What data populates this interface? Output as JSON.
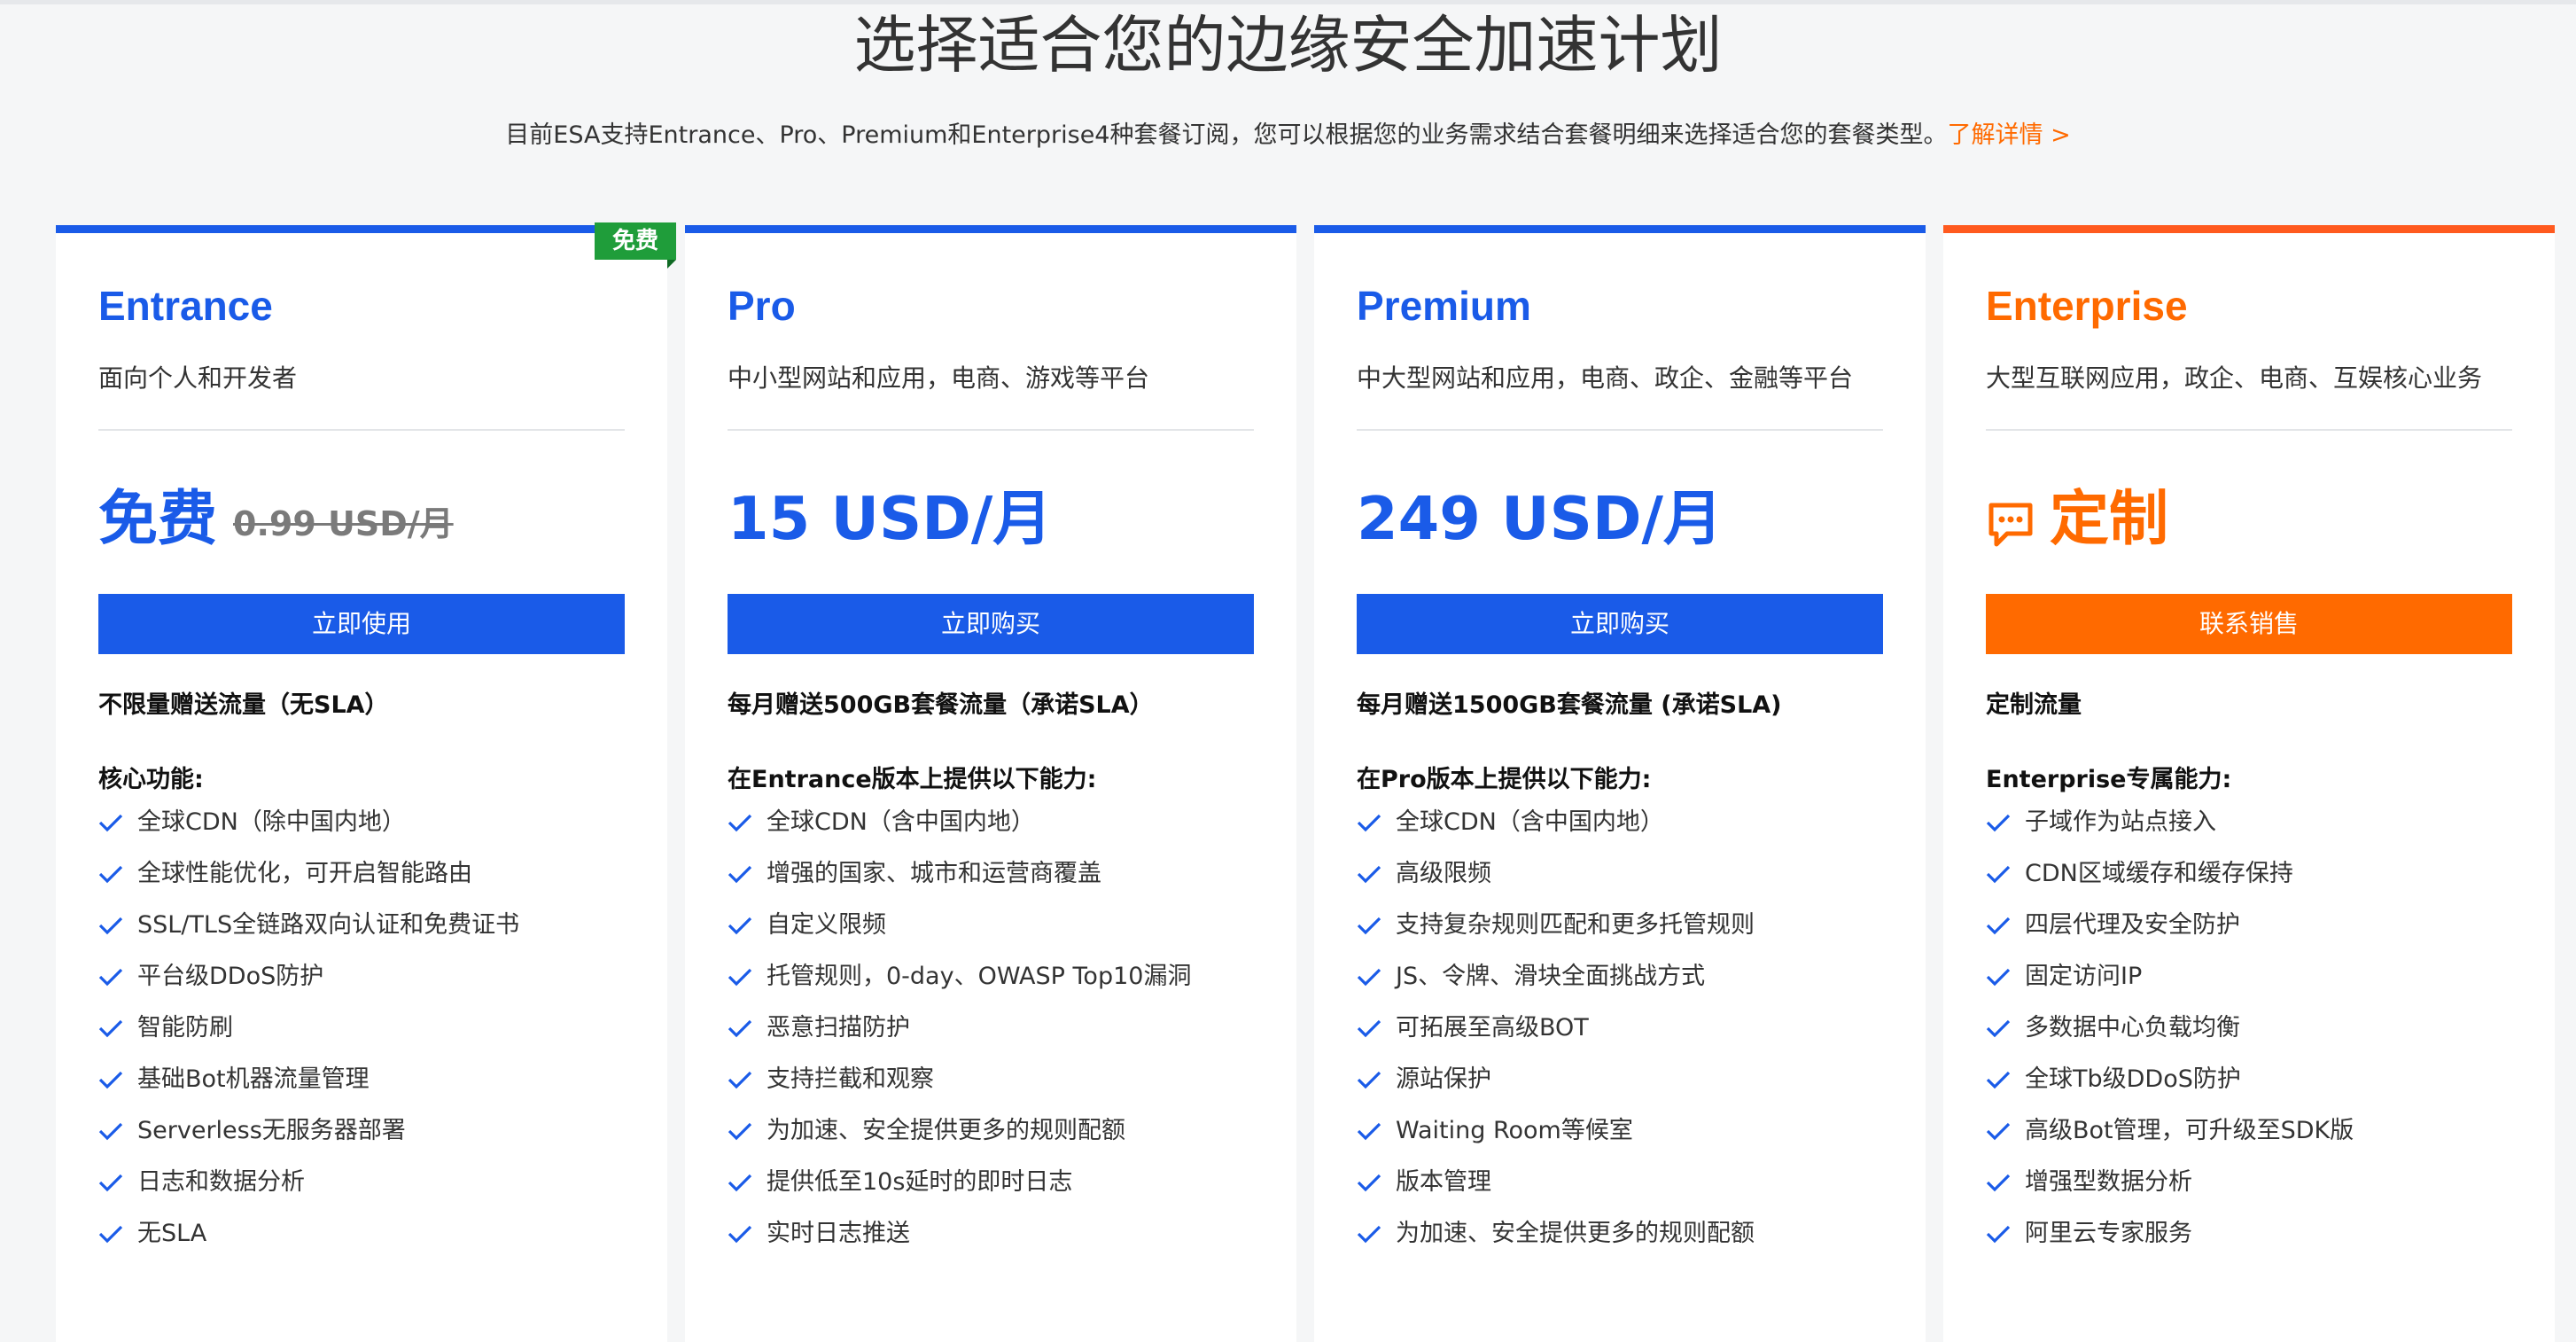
{
  "header": {
    "title": "选择适合您的边缘安全加速计划",
    "subtitle": "目前ESA支持Entrance、Pro、Premium和Enterprise4种套餐订阅，您可以根据您的业务需求结合套餐明细来选择适合您的套餐类型。",
    "learn_more": "了解详情 >"
  },
  "colors": {
    "accent_blue": "#1a5be8",
    "accent_orange": "#ff6a00",
    "badge_green": "#1f9d3a",
    "check_blue": "#1a5be8"
  },
  "plans": [
    {
      "name": "Entrance",
      "badge": "免费",
      "description": "面向个人和开发者",
      "price": "免费",
      "original_price": "0.99 USD/月",
      "cta": "立即使用",
      "traffic": "不限量赠送流量（无SLA）",
      "features_title": "核心功能:",
      "features": [
        "全球CDN（除中国内地）",
        "全球性能优化，可开启智能路由",
        "SSL/TLS全链路双向认证和免费证书",
        "平台级DDoS防护",
        "智能防刷",
        "基础Bot机器流量管理",
        "Serverless无服务器部署",
        "日志和数据分析",
        "无SLA"
      ]
    },
    {
      "name": "Pro",
      "description": "中小型网站和应用，电商、游戏等平台",
      "price": "15 USD/月",
      "cta": "立即购买",
      "traffic": "每月赠送500GB套餐流量（承诺SLA）",
      "features_title": "在Entrance版本上提供以下能力:",
      "features": [
        "全球CDN（含中国内地）",
        "增强的国家、城市和运营商覆盖",
        "自定义限频",
        "托管规则，0-day、OWASP Top10漏洞",
        "恶意扫描防护",
        "支持拦截和观察",
        "为加速、安全提供更多的规则配额",
        "提供低至10s延时的即时日志",
        "实时日志推送"
      ]
    },
    {
      "name": "Premium",
      "description": "中大型网站和应用，电商、政企、金融等平台",
      "price": "249 USD/月",
      "cta": "立即购买",
      "traffic": "每月赠送1500GB套餐流量 (承诺SLA)",
      "features_title": "在Pro版本上提供以下能力:",
      "features": [
        "全球CDN（含中国内地）",
        "高级限频",
        "支持复杂规则匹配和更多托管规则",
        "JS、令牌、滑块全面挑战方式",
        "可拓展至高级BOT",
        "源站保护",
        "Waiting Room等候室",
        "版本管理",
        "为加速、安全提供更多的规则配额"
      ]
    },
    {
      "name": "Enterprise",
      "description": "大型互联网应用，政企、电商、互娱核心业务",
      "price": "定制",
      "price_icon": "chat-bubble-icon",
      "cta": "联系销售",
      "traffic": "定制流量",
      "features_title": "Enterprise专属能力:",
      "features": [
        "子域作为站点接入",
        "CDN区域缓存和缓存保持",
        "四层代理及安全防护",
        "固定访问IP",
        "多数据中心负载均衡",
        "全球Tb级DDoS防护",
        "高级Bot管理，可升级至SDK版",
        "增强型数据分析",
        "阿里云专家服务"
      ]
    }
  ]
}
